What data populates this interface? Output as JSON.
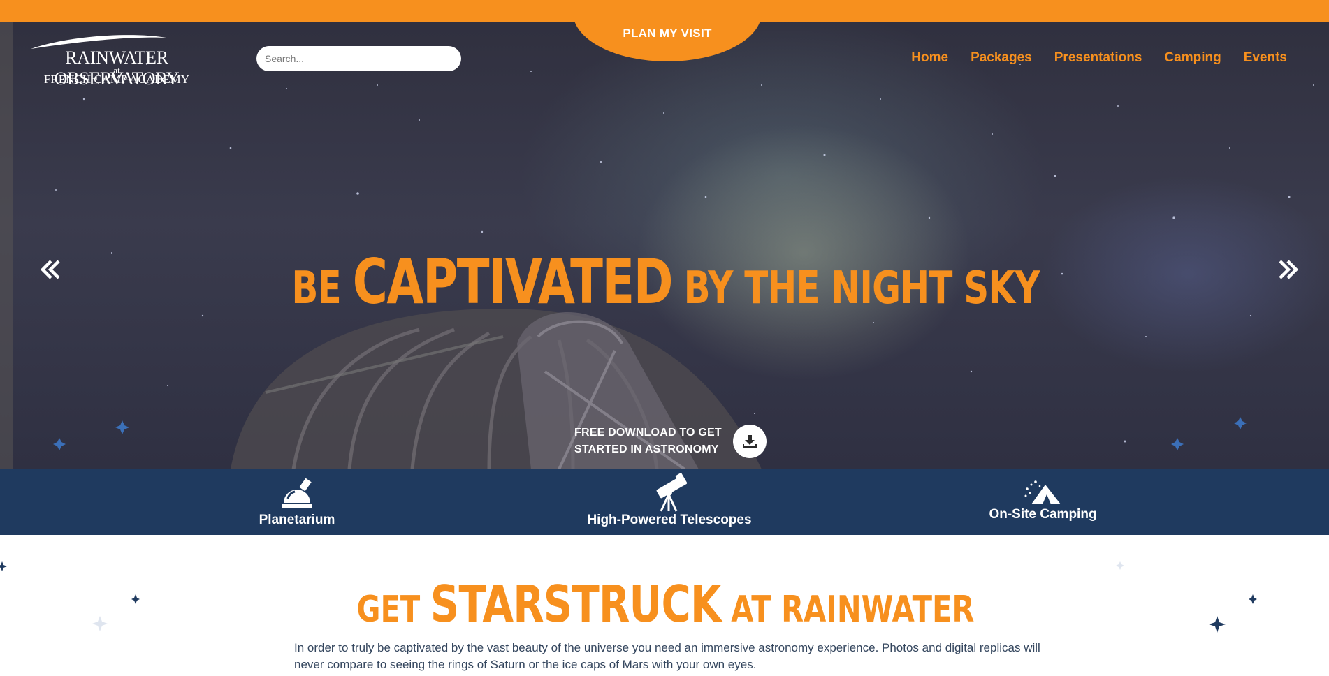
{
  "header": {
    "plan_visit_label": "PLAN MY VISIT",
    "logo": {
      "line1": "RAINWATER OBSERVATORY",
      "line2": "at",
      "line3": "FRENCH CAMP ACADEMY"
    },
    "search_placeholder": "Search...",
    "nav": [
      "Home",
      "Packages",
      "Presentations",
      "Camping",
      "Events"
    ]
  },
  "hero": {
    "headline_pre": "BE ",
    "headline_big": "CAPTIVATED",
    "headline_post": " BY THE NIGHT SKY",
    "download_line1": "FREE DOWNLOAD TO GET",
    "download_line2": "STARTED IN ASTRONOMY",
    "prev_icon": "double-chevron-left-icon",
    "next_icon": "double-chevron-right-icon",
    "download_icon": "download-icon"
  },
  "features": [
    {
      "label": "Planetarium",
      "icon": "observatory-dome-icon"
    },
    {
      "label": "High-Powered Telescopes",
      "icon": "telescope-icon"
    },
    {
      "label": "On-Site Camping",
      "icon": "tent-icon"
    }
  ],
  "intro": {
    "title_pre": "GET ",
    "title_big": "STARSTRUCK",
    "title_post": " AT RAINWATER",
    "body": "In order to truly be captivated by the vast beauty of the universe you need an immersive astronomy experience. Photos and digital replicas will never compare to seeing the rings of Saturn or the ice caps of Mars with your own eyes."
  },
  "colors": {
    "accent_orange": "#f7901e",
    "band_blue": "#1f3a5f",
    "body_text": "#34465e"
  }
}
